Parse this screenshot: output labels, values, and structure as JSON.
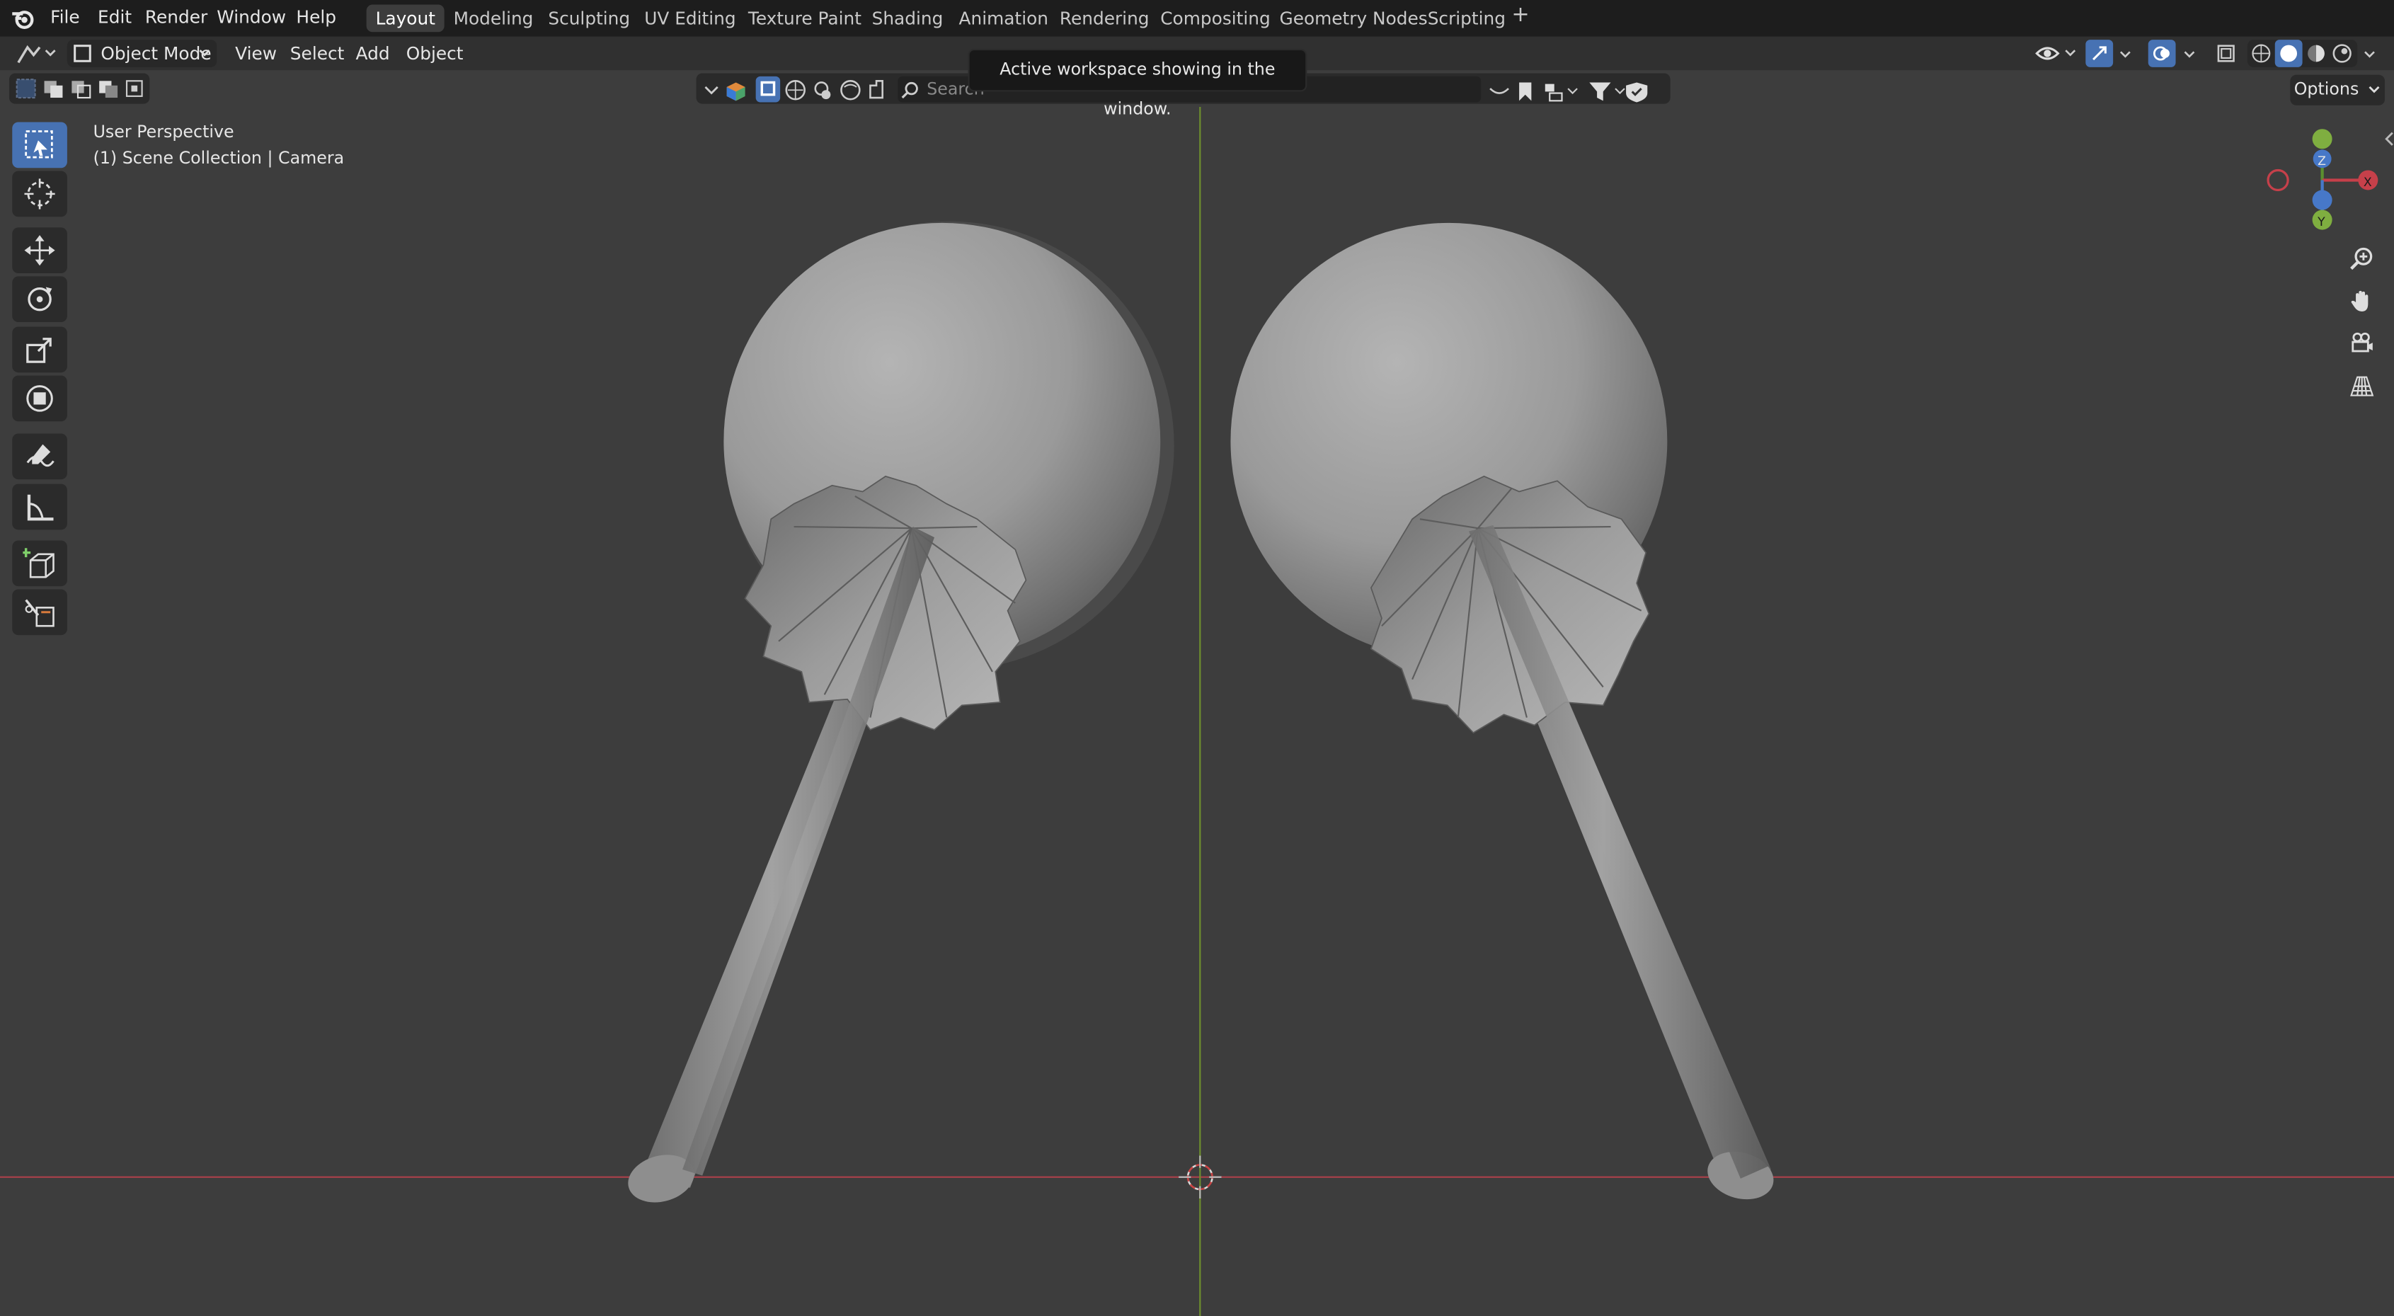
{
  "app": {
    "name": "Blender"
  },
  "menu": [
    {
      "label": "File"
    },
    {
      "label": "Edit"
    },
    {
      "label": "Render"
    },
    {
      "label": "Window"
    },
    {
      "label": "Help"
    }
  ],
  "workspaces": [
    {
      "label": "Layout",
      "active": true
    },
    {
      "label": "Modeling"
    },
    {
      "label": "Sculpting"
    },
    {
      "label": "UV Editing"
    },
    {
      "label": "Texture Paint"
    },
    {
      "label": "Shading"
    },
    {
      "label": "Animation"
    },
    {
      "label": "Rendering"
    },
    {
      "label": "Compositing"
    },
    {
      "label": "Geometry Nodes"
    },
    {
      "label": "Scripting"
    }
  ],
  "workspace_add": "+",
  "header": {
    "mode": "Object Mode",
    "menus": [
      "View",
      "Select",
      "Add",
      "Object"
    ]
  },
  "tooltip": "Active workspace showing in the window.",
  "search": {
    "placeholder": "Search"
  },
  "options_label": "Options",
  "viewport": {
    "view_name": "User Perspective",
    "collection_info": "(1) Scene Collection | Camera",
    "gizmo_axes": [
      "Z",
      "X",
      "Y"
    ]
  },
  "toolbar_icons": [
    "select-box-icon",
    "cursor-icon",
    "move-icon",
    "rotate-icon",
    "scale-icon",
    "transform-icon",
    "annotate-icon",
    "measure-icon",
    "add-cube-icon",
    "knife-icon"
  ],
  "colors": {
    "accent": "#4772b3",
    "x_axis": "#c6404a",
    "y_axis": "#7fae40",
    "z_axis": "#4778c8"
  }
}
